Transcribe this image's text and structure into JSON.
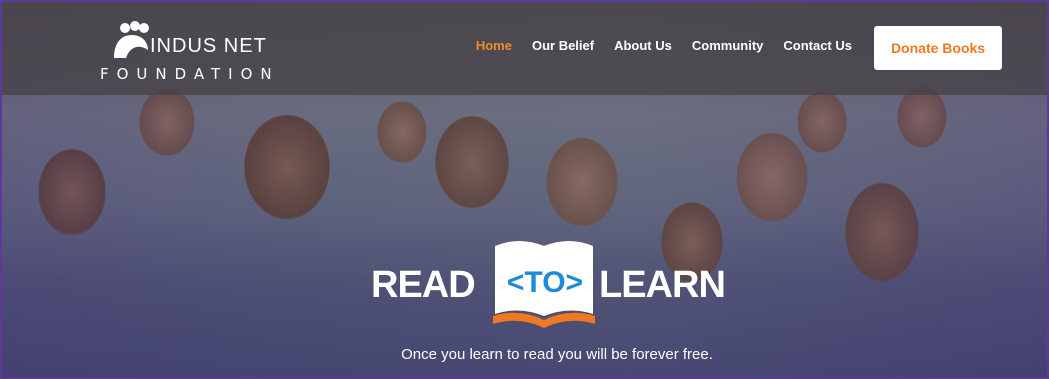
{
  "brand": {
    "name_top": "INDUS NET",
    "name_bottom": "FOUNDATION",
    "icon": "people-silhouette-logo"
  },
  "nav": {
    "items": [
      {
        "label": "Home",
        "active": true
      },
      {
        "label": "Our Belief",
        "active": false
      },
      {
        "label": "About Us",
        "active": false
      },
      {
        "label": "Community",
        "active": false
      },
      {
        "label": "Contact Us",
        "active": false
      }
    ],
    "cta": "Donate Books"
  },
  "hero": {
    "read": "READ",
    "to": "<TO>",
    "learn": "LEARN",
    "tagline": "Once you learn to read you will be forever free."
  },
  "colors": {
    "accent": "#f08a2c",
    "cta_text": "#f07820",
    "to_blue": "#1f8ad6",
    "border": "#5b3a9a",
    "book_orange": "#f07820"
  }
}
